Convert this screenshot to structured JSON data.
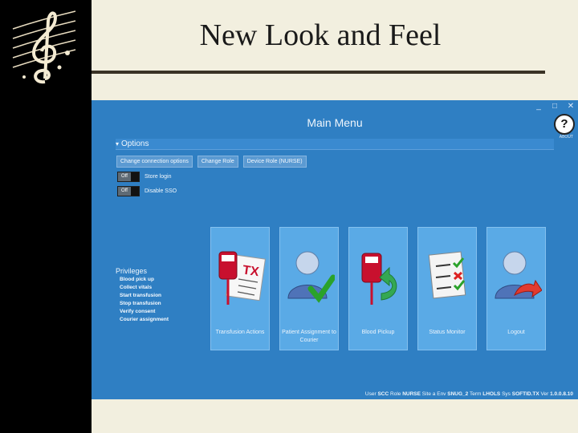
{
  "slide": {
    "title": "New Look and Feel"
  },
  "window": {
    "controls": {
      "minimize": "_",
      "maximize": "□",
      "close": "✕"
    },
    "title": "Main Menu",
    "help": {
      "glyph": "?",
      "label": "ABOUT"
    }
  },
  "options": {
    "header": "Options",
    "buttons": [
      {
        "label": "Change connection options"
      },
      {
        "label": "Change Role"
      },
      {
        "label": "Device Role (NURSE)"
      }
    ],
    "toggles": [
      {
        "state": "Off",
        "label": "Store login"
      },
      {
        "state": "Off",
        "label": "Disable SSO"
      }
    ]
  },
  "privileges": {
    "title": "Privileges",
    "items": [
      "Blood pick up",
      "Collect vitals",
      "Start transfusion",
      "Stop transfusion",
      "Verify consent",
      "Courier assignment"
    ]
  },
  "tiles": [
    {
      "label": "Transfusion Actions",
      "icon": "blood-bag-tx-icon"
    },
    {
      "label": "Patient Assignment to Courier",
      "icon": "user-check-icon"
    },
    {
      "label": "Blood Pickup",
      "icon": "blood-bag-return-icon"
    },
    {
      "label": "Status Monitor",
      "icon": "checklist-icon"
    },
    {
      "label": "Logout",
      "icon": "user-logout-icon"
    }
  ],
  "status": {
    "user_label": "User",
    "user": "SCC",
    "role_label": "Role",
    "role": "NURSE",
    "site_label": "Site",
    "site": "a",
    "env_label": "Env",
    "env": "SNUG_2",
    "term_label": "Term",
    "term": "LHOLS",
    "sys_label": "Sys",
    "sys": "SOFTID.TX",
    "ver_label": "Ver",
    "ver": "1.0.0.8.10"
  }
}
